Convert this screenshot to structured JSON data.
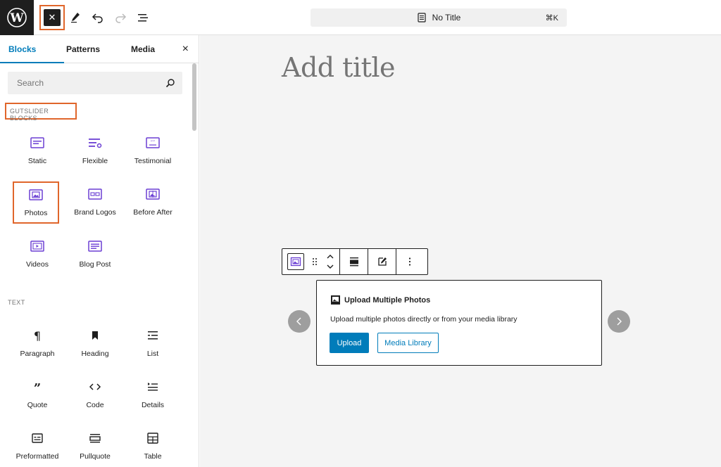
{
  "topbar": {
    "logo_icon": "wordpress-logo-icon",
    "close_inserter_icon": "close-icon",
    "tools_icon": "pencil-icon",
    "undo_icon": "undo-icon",
    "redo_icon": "redo-icon",
    "document_overview_icon": "list-view-icon",
    "document_title": "No Title",
    "command_shortcut": "⌘K"
  },
  "sidebar": {
    "tabs": [
      {
        "label": "Blocks",
        "active": true
      },
      {
        "label": "Patterns",
        "active": false
      },
      {
        "label": "Media",
        "active": false
      }
    ],
    "close_label": "×",
    "search": {
      "placeholder": "Search",
      "value": ""
    },
    "categories": [
      {
        "heading": "GUTSLIDER BLOCKS",
        "blocks": [
          {
            "label": "Static",
            "icon": "static-slider-icon"
          },
          {
            "label": "Flexible",
            "icon": "flexible-slider-icon"
          },
          {
            "label": "Testimonial",
            "icon": "testimonial-icon"
          },
          {
            "label": "Photos",
            "icon": "photos-icon"
          },
          {
            "label": "Brand Logos",
            "icon": "brand-logos-icon"
          },
          {
            "label": "Before After",
            "icon": "before-after-icon"
          },
          {
            "label": "Videos",
            "icon": "videos-icon"
          },
          {
            "label": "Blog Post",
            "icon": "blog-post-icon"
          }
        ]
      },
      {
        "heading": "TEXT",
        "blocks": [
          {
            "label": "Paragraph",
            "icon": "paragraph-icon"
          },
          {
            "label": "Heading",
            "icon": "heading-icon"
          },
          {
            "label": "List",
            "icon": "list-icon"
          },
          {
            "label": "Quote",
            "icon": "quote-icon"
          },
          {
            "label": "Code",
            "icon": "code-icon"
          },
          {
            "label": "Details",
            "icon": "details-icon"
          },
          {
            "label": "Preformatted",
            "icon": "preformatted-icon"
          },
          {
            "label": "Pullquote",
            "icon": "pullquote-icon"
          },
          {
            "label": "Table",
            "icon": "table-icon"
          }
        ]
      }
    ]
  },
  "editor": {
    "title_placeholder": "Add title",
    "block_toolbar": {
      "block_type_icon": "photos-icon",
      "drag_icon": "drag-handle-icon",
      "move_up_icon": "chevron-up-icon",
      "move_down_icon": "chevron-down-icon",
      "align_icon": "align-icon",
      "edit_icon": "edit-icon",
      "options_icon": "more-vertical-icon"
    },
    "placeholder": {
      "title": "Upload Multiple Photos",
      "description": "Upload multiple photos directly or from your media library",
      "upload_label": "Upload",
      "media_library_label": "Media Library"
    },
    "prev_icon": "chevron-left-icon",
    "next_icon": "chevron-right-icon"
  },
  "colors": {
    "accent": "#007cba",
    "gutslider_icon": "#6b3fd4",
    "highlight_outline": "#e0662b",
    "dark": "#1e1e1e"
  }
}
